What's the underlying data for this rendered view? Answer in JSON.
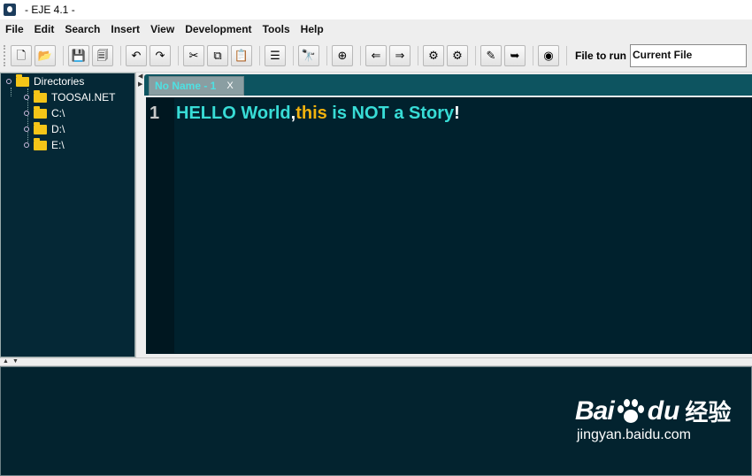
{
  "window": {
    "title": "- EJE 4.1 -",
    "icon": "eje-app-icon"
  },
  "menu": [
    "File",
    "Edit",
    "Search",
    "Insert",
    "View",
    "Development",
    "Tools",
    "Help"
  ],
  "toolbar": {
    "buttons": [
      {
        "name": "new-file-icon",
        "glyph": "🗋"
      },
      {
        "name": "open-file-icon",
        "glyph": "📂"
      },
      {
        "name": "save-icon",
        "glyph": "💾"
      },
      {
        "name": "save-all-icon",
        "glyph": "🗐"
      },
      {
        "name": "undo-icon",
        "glyph": "↶"
      },
      {
        "name": "redo-icon",
        "glyph": "↷"
      },
      {
        "name": "cut-icon",
        "glyph": "✂"
      },
      {
        "name": "copy-icon",
        "glyph": "⧉"
      },
      {
        "name": "paste-icon",
        "glyph": "📋"
      },
      {
        "name": "indent-icon",
        "glyph": "☰"
      },
      {
        "name": "find-icon",
        "glyph": "🔭"
      },
      {
        "name": "add-bookmark-icon",
        "glyph": "⊕"
      },
      {
        "name": "back-arrow-icon",
        "glyph": "⇐"
      },
      {
        "name": "forward-arrow-icon",
        "glyph": "⇒"
      },
      {
        "name": "compile-gear-icon",
        "glyph": "⚙"
      },
      {
        "name": "build-gear-icon",
        "glyph": "⚙"
      },
      {
        "name": "edit-doc-icon",
        "glyph": "✎"
      },
      {
        "name": "export-icon",
        "glyph": "➥"
      },
      {
        "name": "run-icon",
        "glyph": "◉"
      }
    ],
    "file_to_run_label": "File to run",
    "file_to_run_value": "Current File"
  },
  "tree": {
    "root": "Directories",
    "items": [
      "TOOSAI.NET",
      "C:\\",
      "D:\\",
      "E:\\"
    ]
  },
  "editor": {
    "tab_label": "No Name - 1",
    "tab_close": "X",
    "line_number": "1",
    "tokens": [
      {
        "text": "HELLO World",
        "cls": "t-cyan"
      },
      {
        "text": ",",
        "cls": "t-white"
      },
      {
        "text": "this",
        "cls": "t-kw"
      },
      {
        "text": " is NOT a Story",
        "cls": "t-cyan"
      },
      {
        "text": "!",
        "cls": "t-white"
      }
    ]
  },
  "watermark": {
    "brand_left": "Bai",
    "brand_right": "du",
    "brand_cn": "经验",
    "url": "jingyan.baidu.com"
  },
  "colors": {
    "editor_bg": "#00212d",
    "text_cyan": "#38dcd6",
    "keyword": "#f2b20d",
    "tab_bg": "#0d5460"
  }
}
